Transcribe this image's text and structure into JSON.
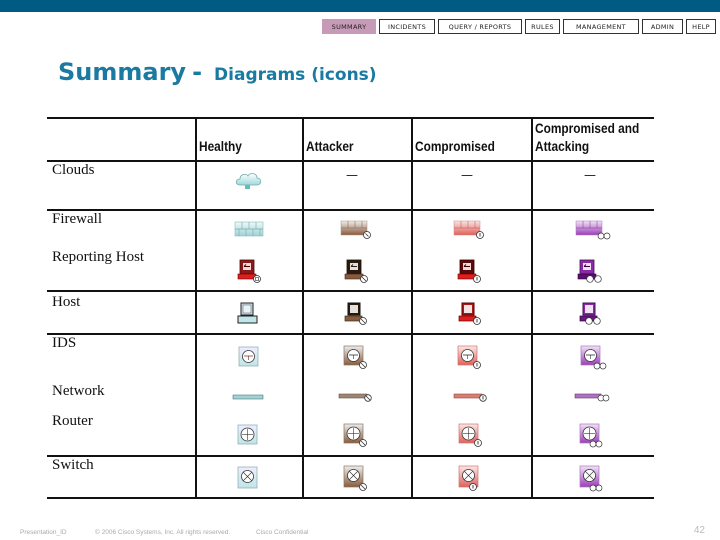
{
  "header": {
    "nav_tabs": [
      {
        "label": "SUMMARY",
        "active": true
      },
      {
        "label": "INCIDENTS",
        "active": false
      },
      {
        "label": "QUERY / REPORTS",
        "active": false
      },
      {
        "label": "RULES",
        "active": false
      },
      {
        "label": "MANAGEMENT",
        "active": false
      },
      {
        "label": "ADMIN",
        "active": false
      },
      {
        "label": "HELP",
        "active": false
      }
    ],
    "bar_color": "#005a82",
    "active_tab_color": "#c79bb8"
  },
  "title": {
    "main": "Summary",
    "separator": "-",
    "sub": "Diagrams  (icons)",
    "color": "#1a7aa1"
  },
  "table": {
    "columns": [
      "Healthy",
      "Attacker",
      "Compromised",
      "Compromised and",
      "Attacking"
    ],
    "column_headers": [
      {
        "line1": "",
        "line2": "Healthy"
      },
      {
        "line1": "",
        "line2": "Attacker"
      },
      {
        "line1": "",
        "line2": "Compromised"
      },
      {
        "line1": "Compromised and",
        "line2": "Attacking"
      }
    ],
    "state_colors": {
      "healthy": "#bfe3e4",
      "attacker": "#8a5a3c",
      "compromised": "#e0463a",
      "compromised_attacking": "#9b3fb8"
    },
    "rows": [
      {
        "label": "Clouds",
        "icon": "cloud-icon",
        "cells": [
          "cloud",
          "—",
          "—",
          "—"
        ]
      },
      {
        "label": "Firewall",
        "icon": "firewall-icon",
        "cells": [
          "firewall",
          "firewall",
          "firewall",
          "firewall"
        ]
      },
      {
        "label": "Reporting Host",
        "icon": "reporting-host-icon",
        "cells": [
          "reporting-host",
          "reporting-host",
          "reporting-host",
          "reporting-host"
        ]
      },
      {
        "label": "Host",
        "icon": "host-icon",
        "cells": [
          "host",
          "host",
          "host",
          "host"
        ]
      },
      {
        "label": "IDS",
        "icon": "ids-icon",
        "cells": [
          "ids",
          "ids",
          "ids",
          "ids"
        ]
      },
      {
        "label": "Network",
        "icon": "network-icon",
        "cells": [
          "network",
          "network",
          "network",
          "network"
        ]
      },
      {
        "label": "Router",
        "icon": "router-icon",
        "cells": [
          "router",
          "router",
          "router",
          "router"
        ]
      },
      {
        "label": "Switch",
        "icon": "switch-icon",
        "cells": [
          "switch",
          "switch",
          "switch",
          "switch"
        ]
      }
    ],
    "empty_mark": "—"
  },
  "footer": {
    "presentation_id": "Presentation_ID",
    "copyright": "© 2006 Cisco Systems, Inc. All rights reserved.",
    "confidential": "Cisco Confidential",
    "page_number": "42"
  }
}
